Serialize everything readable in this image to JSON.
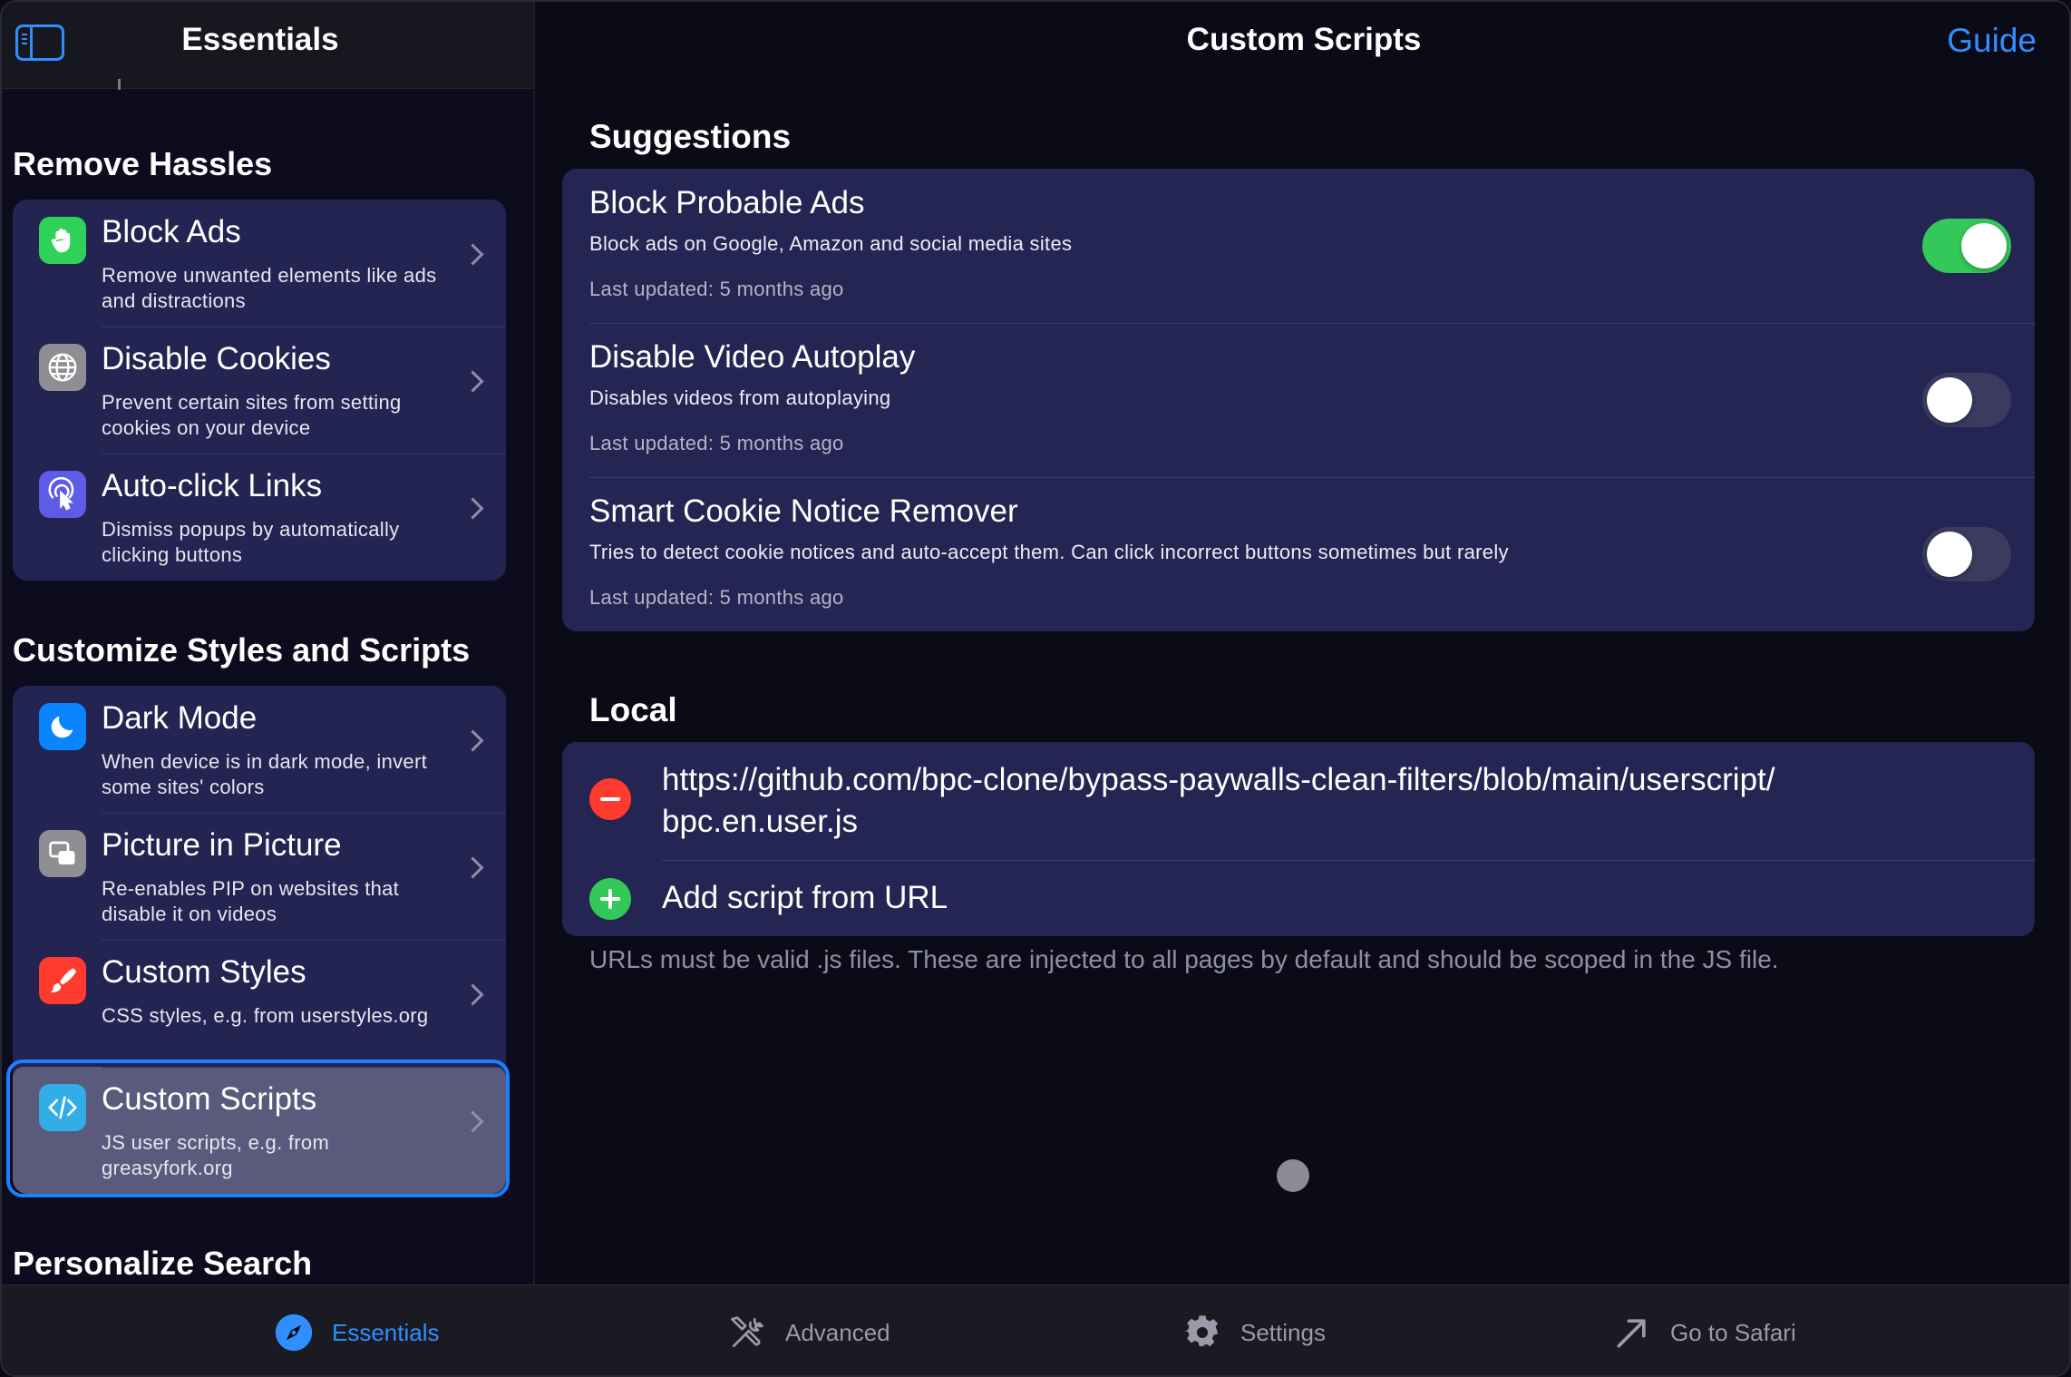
{
  "sidebar": {
    "title": "Essentials",
    "sections": [
      {
        "title": "Remove Hassles",
        "items": [
          {
            "title": "Block Ads",
            "subtitle": "Remove unwanted elements like ads and distractions",
            "icon": "hand-raised-icon",
            "icon_color": "#30d158"
          },
          {
            "title": "Disable Cookies",
            "subtitle": "Prevent certain sites from setting cookies on your device",
            "icon": "globe-icon",
            "icon_color": "#8e8e93"
          },
          {
            "title": "Auto-click Links",
            "subtitle": "Dismiss popups by automatically clicking buttons",
            "icon": "tap-icon",
            "icon_color": "#5e5ce6"
          }
        ]
      },
      {
        "title": "Customize Styles and Scripts",
        "items": [
          {
            "title": "Dark Mode",
            "subtitle": "When device is in dark mode, invert some sites' colors",
            "icon": "moon-icon",
            "icon_color": "#0a84ff"
          },
          {
            "title": "Picture in Picture",
            "subtitle": "Re-enables PIP on websites that disable it on videos",
            "icon": "pip-icon",
            "icon_color": "#8e8e93"
          },
          {
            "title": "Custom Styles",
            "subtitle": "CSS styles, e.g. from userstyles.org",
            "icon": "paintbrush-icon",
            "icon_color": "#ff3b30"
          },
          {
            "title": "Custom Scripts",
            "subtitle": "JS user scripts, e.g. from greasyfork.org",
            "icon": "code-icon",
            "icon_color": "#32ade6",
            "selected": true
          }
        ]
      },
      {
        "title": "Personalize Search"
      }
    ]
  },
  "main": {
    "title": "Custom Scripts",
    "guide_label": "Guide",
    "suggestions": {
      "title": "Suggestions",
      "items": [
        {
          "title": "Block Probable Ads",
          "description": "Block ads on Google, Amazon and social media sites",
          "updated": "Last updated: 5 months ago",
          "enabled": true
        },
        {
          "title": "Disable Video Autoplay",
          "description": "Disables videos from autoplaying",
          "updated": "Last updated: 5 months ago",
          "enabled": false
        },
        {
          "title": "Smart Cookie Notice Remover",
          "description": "Tries to detect cookie notices and auto-accept them. Can click incorrect buttons sometimes but rarely",
          "updated": "Last updated: 5 months ago",
          "enabled": false
        }
      ]
    },
    "local": {
      "title": "Local",
      "script_url_line1": "https://github.com/bpc-clone/bypass-paywalls-clean-filters/blob/main/userscript/",
      "script_url_line2": "bpc.en.user.js",
      "add_label": "Add script from URL",
      "footnote": "URLs must be valid .js files. These are injected to all pages by default and should be scoped in the JS file."
    }
  },
  "tabbar": {
    "tabs": [
      {
        "label": "Essentials",
        "icon": "compass-icon",
        "active": true
      },
      {
        "label": "Advanced",
        "icon": "tools-icon",
        "active": false
      },
      {
        "label": "Settings",
        "icon": "gear-icon",
        "active": false
      },
      {
        "label": "Go to Safari",
        "icon": "arrow-up-right-icon",
        "active": false
      }
    ]
  },
  "colors": {
    "accent": "#2f8fff",
    "toggle_on": "#34c759",
    "card": "#242552",
    "background": "#0b0b18"
  }
}
